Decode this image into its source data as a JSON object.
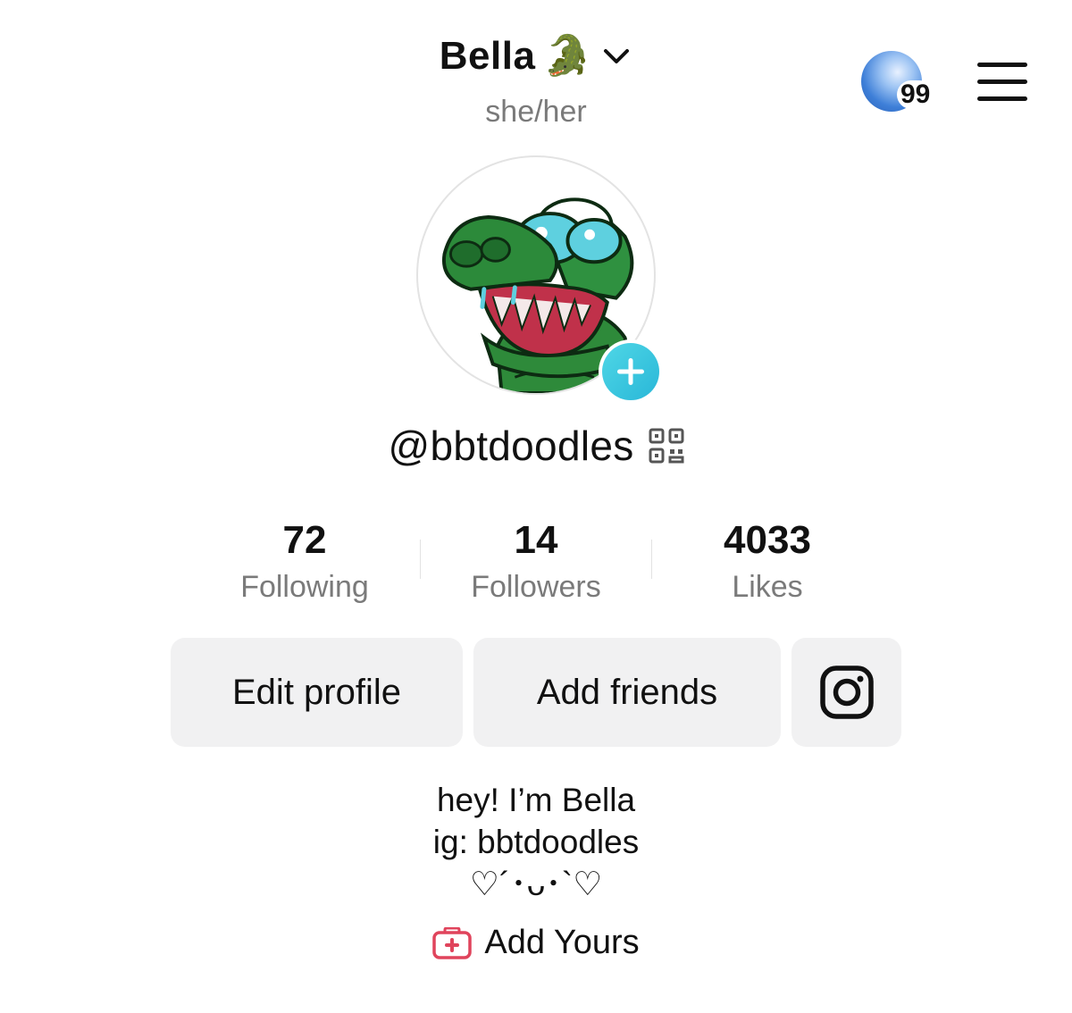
{
  "header": {
    "display_name": "Bella",
    "emoji": "🐊",
    "pronouns": "she/her",
    "notification_count": "99"
  },
  "profile": {
    "username": "@bbtdoodles"
  },
  "stats": [
    {
      "value": "72",
      "label": "Following"
    },
    {
      "value": "14",
      "label": "Followers"
    },
    {
      "value": "4033",
      "label": "Likes"
    }
  ],
  "buttons": {
    "edit_profile": "Edit profile",
    "add_friends": "Add friends"
  },
  "bio": {
    "lines": [
      "hey! I’m Bella",
      "ig: bbtdoodles",
      "♡´･ᴗ･`♡"
    ],
    "add_yours": "Add Yours"
  },
  "colors": {
    "accent_plus": "#29b7d8",
    "add_yours_icon": "#e0445c",
    "button_bg": "#f1f1f2",
    "secondary_text": "#7a7a7a"
  },
  "icons": [
    "chevron-down-icon",
    "menu-icon",
    "plus-icon",
    "qr-code-icon",
    "instagram-icon",
    "add-yours-icon"
  ]
}
